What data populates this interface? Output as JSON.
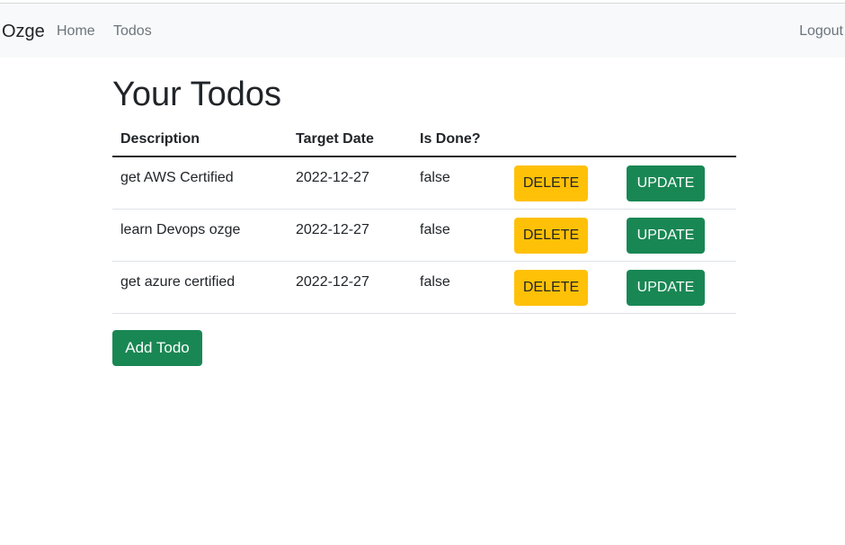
{
  "navbar": {
    "brand": "Ozge",
    "links": [
      {
        "label": "Home"
      },
      {
        "label": "Todos"
      }
    ],
    "logout_label": "Logout"
  },
  "page": {
    "title": "Your Todos"
  },
  "table": {
    "headers": [
      "Description",
      "Target Date",
      "Is Done?"
    ],
    "rows": [
      {
        "description": "get AWS Certified",
        "target_date": "2022-12-27",
        "is_done": "false",
        "delete_label": "DELETE",
        "update_label": "UPDATE"
      },
      {
        "description": "learn Devops ozge",
        "target_date": "2022-12-27",
        "is_done": "false",
        "delete_label": "DELETE",
        "update_label": "UPDATE"
      },
      {
        "description": "get azure certified",
        "target_date": "2022-12-27",
        "is_done": "false",
        "delete_label": "DELETE",
        "update_label": "UPDATE"
      }
    ]
  },
  "actions": {
    "add_label": "Add Todo"
  },
  "colors": {
    "navbar_bg": "#f8f9fa",
    "warning": "#ffc107",
    "success": "#198754"
  }
}
